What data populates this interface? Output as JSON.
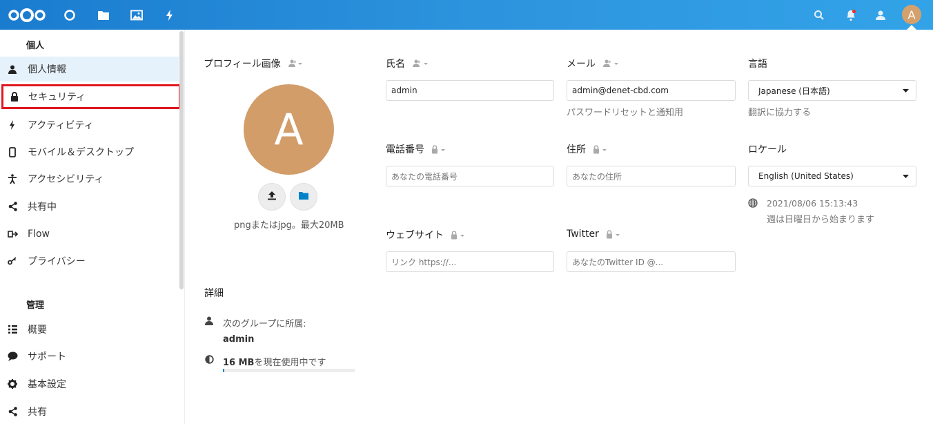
{
  "header": {
    "icons": [
      "nextcloud-logo",
      "dashboard-icon",
      "files-icon",
      "photos-icon",
      "activity-icon",
      "search-icon",
      "notifications-icon",
      "contacts-icon"
    ],
    "avatar_letter": "A",
    "accent": "#1a7ccf"
  },
  "sidebar": {
    "personal_title": "個人",
    "admin_title": "管理",
    "personal_items": [
      {
        "label": "個人情報",
        "icon": "user-icon"
      },
      {
        "label": "セキュリティ",
        "icon": "lock-icon"
      },
      {
        "label": "アクティビティ",
        "icon": "activity-icon"
      },
      {
        "label": "モバイル＆デスクトップ",
        "icon": "phone-icon"
      },
      {
        "label": "アクセシビリティ",
        "icon": "accessibility-icon"
      },
      {
        "label": "共有中",
        "icon": "share-icon"
      },
      {
        "label": "Flow",
        "icon": "flow-icon"
      },
      {
        "label": "プライバシー",
        "icon": "key-icon"
      }
    ],
    "admin_items": [
      {
        "label": "概要",
        "icon": "overview-icon"
      },
      {
        "label": "サポート",
        "icon": "support-icon"
      },
      {
        "label": "基本設定",
        "icon": "gear-icon"
      },
      {
        "label": "共有",
        "icon": "share-icon"
      }
    ]
  },
  "profile": {
    "picture_label": "プロフィール画像",
    "avatar_letter": "A",
    "picture_hint": "pngまたはjpg。最大20MB"
  },
  "fields": {
    "name": {
      "label": "氏名",
      "value": "admin"
    },
    "email": {
      "label": "メール",
      "value": "admin@denet-cbd.com",
      "hint": "パスワードリセットと通知用"
    },
    "language": {
      "label": "言語",
      "value": "Japanese (日本語)",
      "hint": "翻訳に協力する"
    },
    "phone": {
      "label": "電話番号",
      "placeholder": "あなたの電話番号"
    },
    "address": {
      "label": "住所",
      "placeholder": "あなたの住所"
    },
    "locale": {
      "label": "ロケール",
      "value": "English (United States)",
      "datetime": "2021/08/06 15:13:43",
      "week_start": "週は日曜日から始まります"
    },
    "website": {
      "label": "ウェブサイト",
      "placeholder": "リンク https://..."
    },
    "twitter": {
      "label": "Twitter",
      "placeholder": "あなたのTwitter ID @..."
    }
  },
  "details": {
    "title": "詳細",
    "groups_label": "次のグループに所属:",
    "group_name": "admin",
    "quota_amount": "16 MB",
    "quota_suffix": "を現在使用中です",
    "quota_fraction": 0.01
  }
}
